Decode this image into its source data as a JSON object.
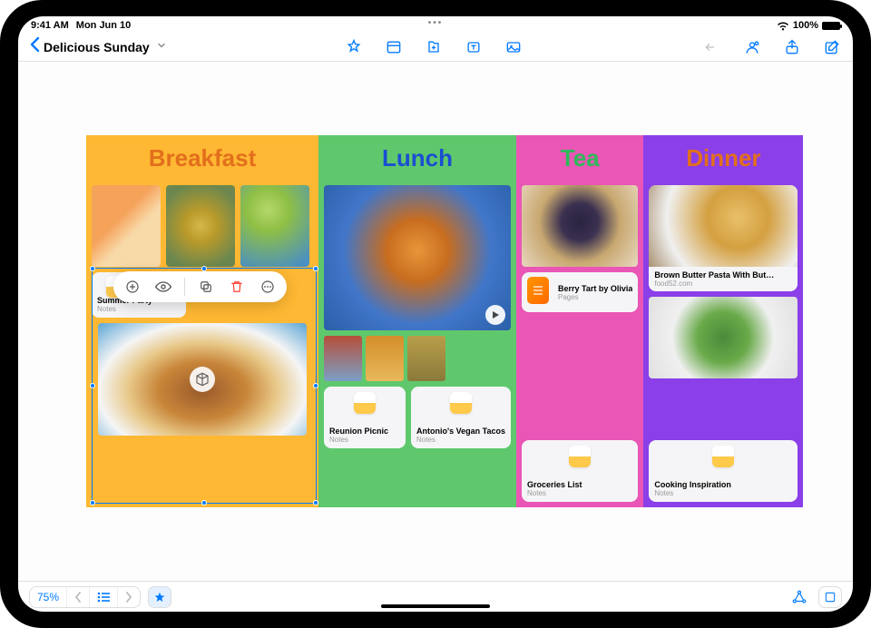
{
  "status": {
    "time": "9:41 AM",
    "date": "Mon Jun 10",
    "battery_pct": "100%"
  },
  "toolbar": {
    "doc_title": "Delicious Sunday"
  },
  "columns": {
    "breakfast": {
      "heading": "Breakfast"
    },
    "lunch": {
      "heading": "Lunch"
    },
    "tea": {
      "heading": "Tea"
    },
    "dinner": {
      "heading": "Dinner"
    }
  },
  "cards": {
    "summer_party": {
      "title": "Summer Party",
      "subtitle": "Notes"
    },
    "reunion_picnic": {
      "title": "Reunion Picnic",
      "subtitle": "Notes"
    },
    "vegan_tacos": {
      "title": "Antonio's Vegan Tacos",
      "subtitle": "Notes"
    },
    "berry_tart": {
      "title": "Berry Tart by Olivia",
      "subtitle": "Pages"
    },
    "groceries": {
      "title": "Groceries List",
      "subtitle": "Notes"
    },
    "pasta_link": {
      "title": "Brown Butter Pasta With But…",
      "subtitle": "food52.com"
    },
    "cooking_inspiration": {
      "title": "Cooking Inspiration",
      "subtitle": "Notes"
    }
  },
  "bottombar": {
    "zoom": "75%"
  }
}
